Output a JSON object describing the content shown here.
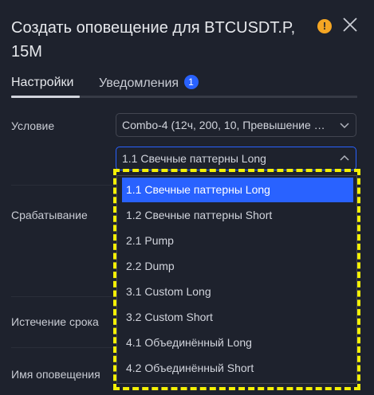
{
  "dialog": {
    "title": "Создать оповещение для BTCUSDT.P, 15M",
    "warning_icon": "warning-icon",
    "close_icon": "close-icon"
  },
  "tabs": [
    {
      "label": "Настройки",
      "active": true
    },
    {
      "label": "Уведомления",
      "badge": "1"
    }
  ],
  "form": {
    "condition_label": "Условие",
    "condition_value": "Combo-4 (12ч, 200, 10, Превышение …",
    "pattern_value": "1.1 Свечные паттерны Long",
    "trigger_label": "Срабатывание",
    "expiration_label": "Истечение срока",
    "alert_name_label": "Имя оповещения"
  },
  "dropdown": {
    "options": [
      "1.1 Свечные паттерны Long",
      "1.2 Свечные паттерны Short",
      "2.1 Pump",
      "2.2 Dump",
      "3.1 Custom Long",
      "3.2 Custom Short",
      "4.1 Объединённый Long",
      "4.2 Объединённый Short"
    ],
    "selected_index": 0
  },
  "colors": {
    "background": "#1e222d",
    "accent": "#2962ff",
    "warning": "#f5a623",
    "highlight": "#f4f005"
  }
}
